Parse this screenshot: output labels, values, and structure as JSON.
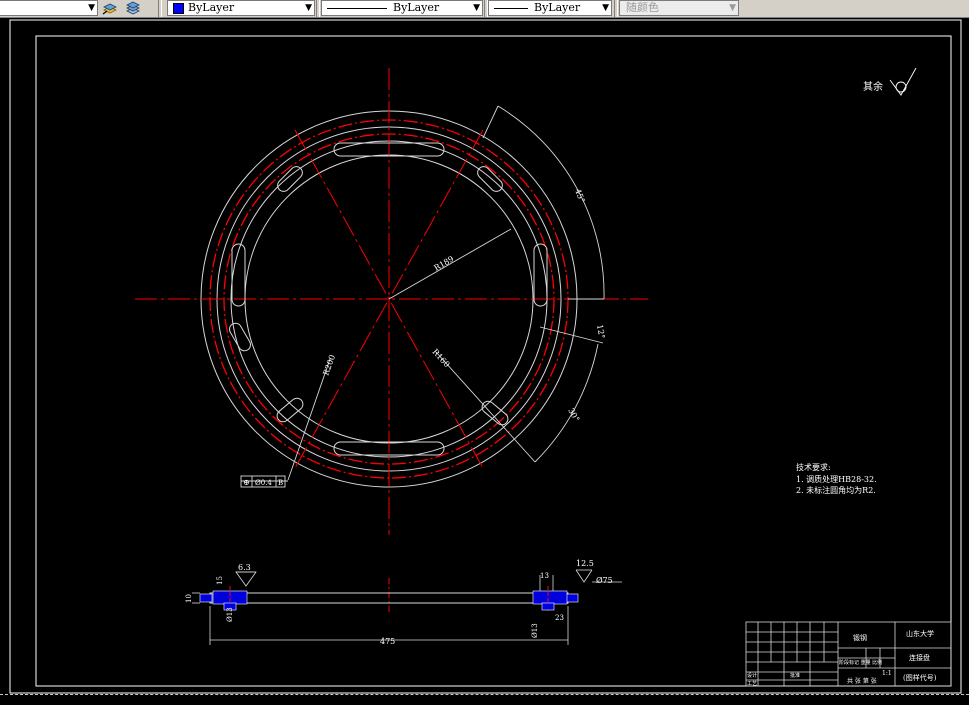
{
  "toolbar": {
    "layer_arrow": "▼",
    "color_value": "ByLayer",
    "linetype_value": "ByLayer",
    "lineweight_value": "ByLayer",
    "plotstyle_value": "随颜色",
    "arrow": "▼"
  },
  "drawing": {
    "roughness_label": "其余",
    "dim_radius": "R189",
    "dim_chord": "R160",
    "dim_small": "R200",
    "dim_angle_outer": "45°",
    "dim_angle_right1": "12°",
    "dim_angle_right2": "30°",
    "gdt_symbol": "⊕",
    "gdt_value": "Ø0.4",
    "gdt_ref": "B",
    "tech_req_title": "技术要求:",
    "tech_req_1": "1. 调质处理HB28-32.",
    "tech_req_2": "2. 未标注圆角均为R2.",
    "sec_rough_left": "6.3",
    "sec_rough_right": "12.5",
    "sec_dim_overall": "475",
    "sec_dim_left_h": "10",
    "sec_dim_ring": "15",
    "sec_dim_ring_r": "13",
    "sec_dim_small_r": "23",
    "sec_dim_phi": "Ø13",
    "sec_dim_phi_r": "Ø13",
    "sec_dim_right": "Ø75"
  },
  "title_block": {
    "material": "锻钢",
    "school": "山东大学",
    "part_name": "连接盘",
    "drawing_no": "(图样代号)",
    "scale_row": "阶段标记  重量  比例",
    "scale": "1:1",
    "sheets": "共 张  第 张",
    "designer": "设计",
    "process": "工艺",
    "approve": "批准"
  }
}
